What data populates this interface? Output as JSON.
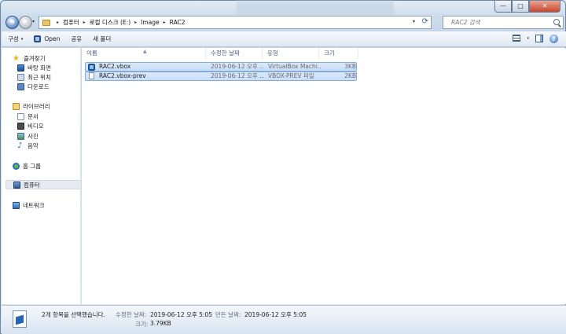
{
  "window": {
    "controls": {
      "minimize": "—",
      "maximize": "□",
      "close": "✕"
    }
  },
  "nav": {
    "back_icon": "arrow-left-icon",
    "forward_icon": "arrow-right-icon",
    "dropdown": "▾"
  },
  "address": {
    "breadcrumbs": [
      "컴퓨터",
      "로컬 디스크 (E:)",
      "Image",
      "RAC2"
    ],
    "separator": "▸",
    "dropdown": "▾",
    "refresh": "⟳"
  },
  "search": {
    "placeholder": "RAC2 검색"
  },
  "toolbar": {
    "organize": "구성",
    "open": "Open",
    "share": "공유",
    "new_folder": "새 폴더",
    "chevron": "▾"
  },
  "sidebar": {
    "items": [
      {
        "label": "즐겨찾기",
        "icon": "star-icon"
      },
      {
        "label": "바탕 화면",
        "icon": "desktop-icon"
      },
      {
        "label": "최근 위치",
        "icon": "recent-places-icon"
      },
      {
        "label": "다운로드",
        "icon": "downloads-icon"
      },
      {
        "label": "라이브러리",
        "icon": "libraries-icon"
      },
      {
        "label": "문서",
        "icon": "documents-icon"
      },
      {
        "label": "비디오",
        "icon": "videos-icon"
      },
      {
        "label": "사진",
        "icon": "pictures-icon"
      },
      {
        "label": "음악",
        "icon": "music-icon"
      },
      {
        "label": "홈 그룹",
        "icon": "homegroup-icon"
      },
      {
        "label": "컴퓨터",
        "icon": "computer-icon"
      },
      {
        "label": "네트워크",
        "icon": "network-icon"
      }
    ]
  },
  "columns": {
    "name": "이름",
    "date": "수정한 날짜",
    "type": "유형",
    "size": "크기",
    "sort_arrow": "▲"
  },
  "files": [
    {
      "name": "RAC2.vbox",
      "date": "2019-06-12 오후 ...",
      "type": "VirtualBox Machi...",
      "size": "3KB",
      "icon": "virtualbox-icon"
    },
    {
      "name": "RAC2.vbox-prev",
      "date": "2019-06-12 오후 ...",
      "type": "VBOX-PREV 파일",
      "size": "2KB",
      "icon": "file-icon"
    }
  ],
  "details": {
    "selected": "2개 항목을 선택했습니다.",
    "modified_label": "수정한 날짜:",
    "modified_value": "2019-06-12 오후 5:05",
    "created_label": "만든 날짜:",
    "created_value": "2019-06-12 오후 5:05",
    "size_label": "크기:",
    "size_value": "3.79KB"
  },
  "colors": {
    "selection": "#cce0fa",
    "selection_border": "#84acdd",
    "chrome": "#dbe6f2"
  }
}
